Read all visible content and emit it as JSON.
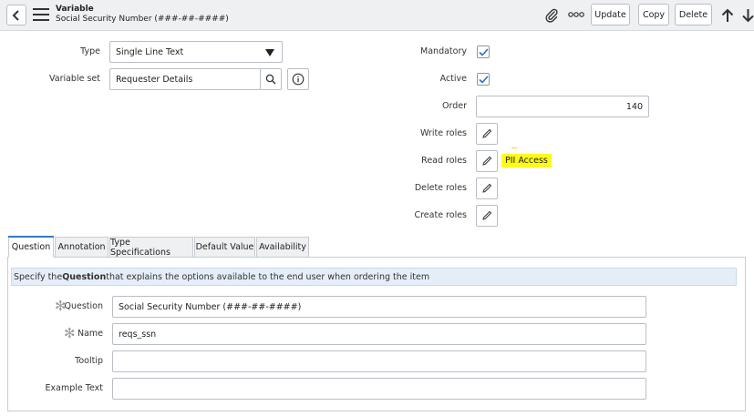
{
  "header": {
    "title": "Variable",
    "subtitle": "Social Security Number (###-##-####)",
    "buttons": {
      "update": "Update",
      "copy": "Copy",
      "delete": "Delete"
    },
    "icons": [
      "back-icon",
      "menu-icon",
      "attachment-icon",
      "more-options-icon",
      "arrow-up-icon",
      "arrow-down-icon"
    ]
  },
  "form": {
    "type": {
      "label": "Type",
      "value": "Single Line Text"
    },
    "variable_set": {
      "label": "Variable set",
      "value": "Requester Details"
    },
    "mandatory": {
      "label": "Mandatory",
      "checked": true
    },
    "active": {
      "label": "Active",
      "checked": true
    },
    "order": {
      "label": "Order",
      "value": "140"
    },
    "write_roles": {
      "label": "Write roles",
      "value": ""
    },
    "read_roles": {
      "label": "Read roles",
      "value": "PII Access"
    },
    "delete_roles": {
      "label": "Delete roles",
      "value": ""
    },
    "create_roles": {
      "label": "Create roles",
      "value": ""
    }
  },
  "tabs": [
    {
      "label": "Question",
      "active": true
    },
    {
      "label": "Annotation"
    },
    {
      "label": "Type Specifications"
    },
    {
      "label": "Default Value"
    },
    {
      "label": "Availability"
    }
  ],
  "question_tab": {
    "info_pre": "Specify the ",
    "info_bold": "Question",
    "info_post": " that explains the options available to the end user when ordering the item",
    "question": {
      "label": "Question",
      "value": "Social Security Number (###-##-####)"
    },
    "name": {
      "label": "Name",
      "value": "reqs_ssn"
    },
    "tooltip": {
      "label": "Tooltip",
      "value": ""
    },
    "example_text": {
      "label": "Example Text",
      "value": ""
    }
  },
  "colors": {
    "accent": "#3478c5",
    "highlight": "#fffa1a",
    "checkmark": "#2f6fbf"
  }
}
